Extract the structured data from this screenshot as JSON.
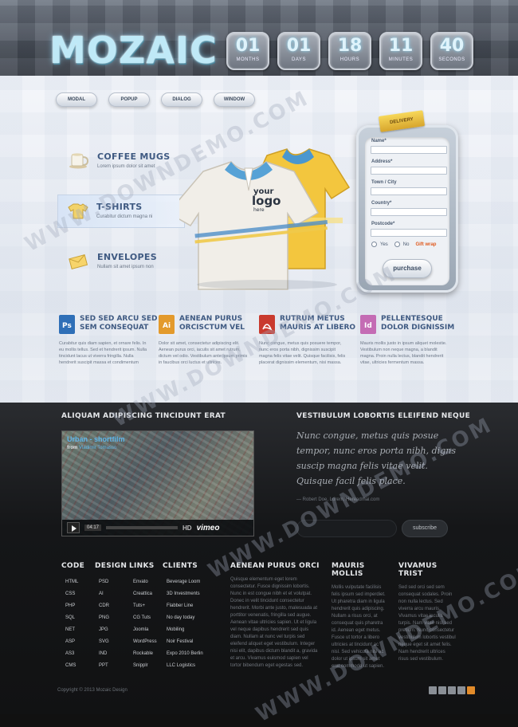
{
  "header": {
    "logo": "MOZAIC",
    "countdown": [
      {
        "value": "01",
        "label": "MONTHS"
      },
      {
        "value": "01",
        "label": "DAYS"
      },
      {
        "value": "18",
        "label": "HOURS"
      },
      {
        "value": "11",
        "label": "MINUTES"
      },
      {
        "value": "40",
        "label": "SECONDS"
      }
    ]
  },
  "tabs": [
    "MODAL",
    "POPUP",
    "DIALOG",
    "WINDOW"
  ],
  "features": [
    {
      "title": "COFFEE MUGS",
      "desc": "Lorem ipsum dolor sit amet",
      "icon": "mug-icon"
    },
    {
      "title": "T-SHIRTS",
      "desc": "Curabitur dictum magna ni",
      "icon": "tshirt-icon"
    },
    {
      "title": "ENVELOPES",
      "desc": "Nullam sit amet ipsum non",
      "icon": "envelope-icon"
    }
  ],
  "product": {
    "logo_line1": "your",
    "logo_line2": "logo",
    "logo_line3": "here"
  },
  "form": {
    "ticket": "DELIVERY",
    "fields": [
      "Name*",
      "Address*",
      "Town / City",
      "Country*",
      "Postcode*"
    ],
    "radio_yes": "Yes",
    "radio_no": "No",
    "gift": "Gift wrap",
    "button": "purchase"
  },
  "columns": [
    {
      "icon": "Ps",
      "color": "#2f6fb7",
      "title1": "SED SED ARCU SED",
      "title2": "SEM CONSEQUAT",
      "text": "Curabitur quis diam sapien, et ornare felis. In eu mollis tellus. Sed et hendrerit ipsum. Nulla tincidunt lacus ut viverra fringilla. Nulla hendrerit suscipit massa et condimentum"
    },
    {
      "icon": "Ai",
      "color": "#e39a2c",
      "title1": "AENEAN PURUS",
      "title2": "ORCISCTUM VEL",
      "text": "Dolor sit amet, consectetur adipiscing elit. Aenean purus orci, iaculis sit amet rutrum, dictum vel odio. Vestibulum ante ipsum primis in faucibus orci luctus et ultrices."
    },
    {
      "icon": "Acr",
      "color": "#c93a2e",
      "title1": "RUTRUM METUS",
      "title2": "MAURIS AT LIBERO",
      "text": "Nunc congue, metus quis posuere tempor, nunc eros porta nibh, dignissim suscipit magna felis vitae velit. Quisque facilisis, felis placerat dignissim elementum, nisi massa."
    },
    {
      "icon": "Id",
      "color": "#c46cb4",
      "title1": "PELLENTESQUE",
      "title2": "DOLOR DIGNISSIM",
      "text": "Mauris mollis justo in ipsum aliquet molestie. Vestibulum non neque magna, a blandit magna. Proin nulla lectus, blandit hendrerit vitae, ultricies fermentum massa."
    }
  ],
  "dark": {
    "left_title": "ALIQUAM ADIPISCING TINCIDUNT ERAT",
    "right_title": "VESTIBULUM LOBORTIS ELEIFEND NEQUE",
    "video_title": "Urban - shortfilm",
    "video_from": "from",
    "video_author": "Vladimir Tomasso",
    "video_time": "04:17",
    "video_hd": "HD",
    "video_brand": "vimeo",
    "script_text": "Nunc congue, metus quis posue tempor, nunc eros porta nibh, digns suscip magna felis vitae velit. Quisque facil felis place.",
    "script_author": "— Robert Doe, Lorem, Hereadmai.com",
    "subscribe": "subscribe"
  },
  "footer_lists": [
    {
      "title": "CODE",
      "items": [
        "HTML",
        "CSS",
        "PHP",
        "SQL",
        "NET",
        "ASP",
        "AS3",
        "CMS"
      ]
    },
    {
      "title": "DESIGN",
      "items": [
        "PSD",
        "AI",
        "CDR",
        "PNG",
        "JPG",
        "SVG",
        "IND",
        "PPT"
      ]
    },
    {
      "title": "LINKS",
      "items": [
        "Envato",
        "Creattica",
        "Tuts+",
        "CG Tuts",
        "Joomla",
        "WordPress",
        "Rockable",
        "Snipplr"
      ]
    },
    {
      "title": "CLIENTS",
      "items": [
        "Beverage Loom",
        "3D Investments",
        "Flabber Line",
        "No day today",
        "Mobiling",
        "Noir Festival",
        "Expo 2010 Berlin",
        "LLC Logistics"
      ]
    }
  ],
  "footer_text_cols": [
    {
      "title": "AENEAN PURUS ORCI",
      "text": "Quisque elementum eget lorem consectetur. Fusce dignissim lobortis. Nunc in est congue nibh et et volutpat. Donec in velit tincidunt consectetur hendrerit. Morbi ante justo, malesuada at porttitor venenatis, fringilla sed augue. Aenean vitae ultricies sapien. Ut et ligula vel neque dapibus hendrerit sed quis diam. Nullam at nunc vel turpis sed eleifend aliquet eget vestibulum. Integer nisi elit, dapibus dictum blandit a, gravida et arcu. Vivamus euismod sapien vel tortor bibendum eget egestas sed."
    },
    {
      "title": "MAURIS MOLLIS",
      "text": "Mollis vulputate facilisis felis ipsum sed imperdiet. Ut pharetra diam in ligula hendrerit quis adipiscing. Nullam a risus orci, at consequat quis pharetra id. Aenean eget metus. Fusce ut tortor a libero ultricies at tincidunt ac nisl. Sed vehicula nisi ac dolor ut ipsum sit amet erat commodo ut sapien."
    },
    {
      "title": "VIVAMUS TRIST",
      "text": "Sed sed orci sed sem consequat sodales. Proin non nulla lectus. Sed viverra arcu mauris. Vivamus vitae iaculis turpis. Nam vitae nisl sed pretium. Nunc consectetur vestibulum lobortis vestibul neque eget sit amet felis. Nam hendrerit ultrices risus sed vestibulum."
    }
  ],
  "footer": {
    "copyright": "Copyright © 2013 Mozaic Design"
  },
  "watermark": "WWW.DOWNDEMO.COM"
}
